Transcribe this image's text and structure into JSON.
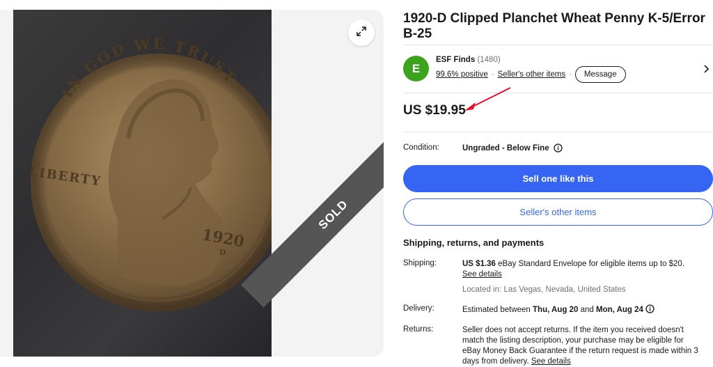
{
  "gallery": {
    "image_alt": "1920-D Lincoln wheat penny with clipped planchet",
    "coin_text": {
      "motto": "IN GOD WE TRUST",
      "liberty": "LIBERTY",
      "year": "1920",
      "mint": "D"
    },
    "badge": "SOLD",
    "expand_icon": "expand-icon",
    "next_icon": "chevron-right-icon"
  },
  "listing": {
    "title": "1920-D Clipped Planchet Wheat Penny K-5/Error B-25",
    "price": "US $19.95",
    "annotation_color": "#e8102a",
    "condition_label": "Condition:",
    "condition_value": "Ungraded - Below Fine"
  },
  "seller": {
    "initial": "E",
    "name": "ESF Finds",
    "feedback_count": "(1480)",
    "positive": "99.6% positive",
    "other_items": "Seller's other items",
    "message": "Message",
    "avatar_color": "#3ca41c"
  },
  "actions": {
    "primary": "Sell one like this",
    "secondary": "Seller's other items",
    "accent_color": "#3665f3"
  },
  "shipping": {
    "section_title": "Shipping, returns, and payments",
    "shipping_label": "Shipping:",
    "shipping_price": "US $1.36",
    "shipping_desc": "eBay Standard Envelope for eligible items up to $20.",
    "see_details": "See details",
    "location": "Located in: Las Vegas, Nevada, United States",
    "delivery_label": "Delivery:",
    "delivery_prefix": "Estimated between",
    "delivery_start": "Thu, Aug 20",
    "delivery_and": "and",
    "delivery_end": "Mon, Aug 24",
    "returns_label": "Returns:",
    "returns_text": "Seller does not accept returns. If the item you received doesn't match the listing description, your purchase may be eligible for eBay Money Back Guarantee if the return request is made within 3 days from delivery.",
    "returns_link": "See details"
  }
}
